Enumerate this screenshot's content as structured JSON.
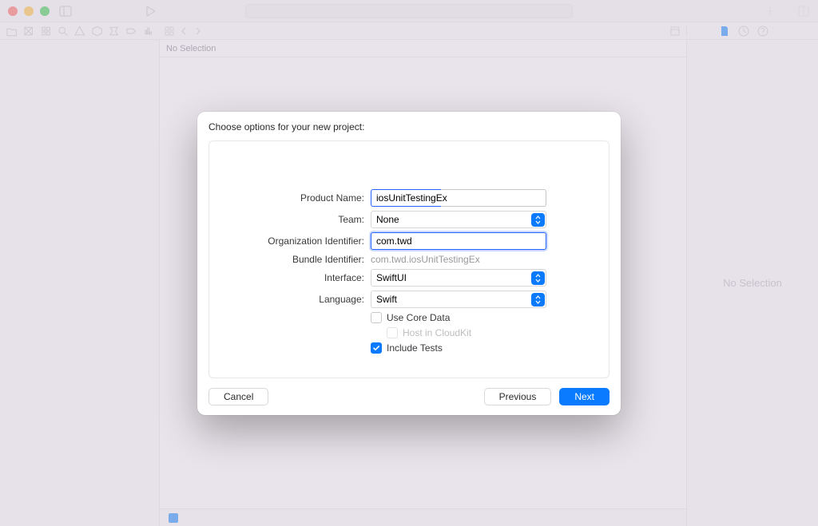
{
  "dialog": {
    "title": "Choose options for your new project:",
    "fields": {
      "product_name": {
        "label": "Product Name:",
        "value": "iosUnitTestingEx"
      },
      "team": {
        "label": "Team:",
        "value": "None"
      },
      "org_id": {
        "label": "Organization Identifier:",
        "value": "com.twd"
      },
      "bundle_id": {
        "label": "Bundle Identifier:",
        "value": "com.twd.iosUnitTestingEx"
      },
      "interface": {
        "label": "Interface:",
        "value": "SwiftUI"
      },
      "language": {
        "label": "Language:",
        "value": "Swift"
      },
      "use_core_data": {
        "label": "Use Core Data"
      },
      "host_cloudkit": {
        "label": "Host in CloudKit"
      },
      "include_tests": {
        "label": "Include Tests"
      }
    },
    "buttons": {
      "cancel": "Cancel",
      "previous": "Previous",
      "next": "Next"
    }
  },
  "editor": {
    "no_selection": "No Selection"
  },
  "inspector": {
    "no_selection": "No Selection"
  }
}
